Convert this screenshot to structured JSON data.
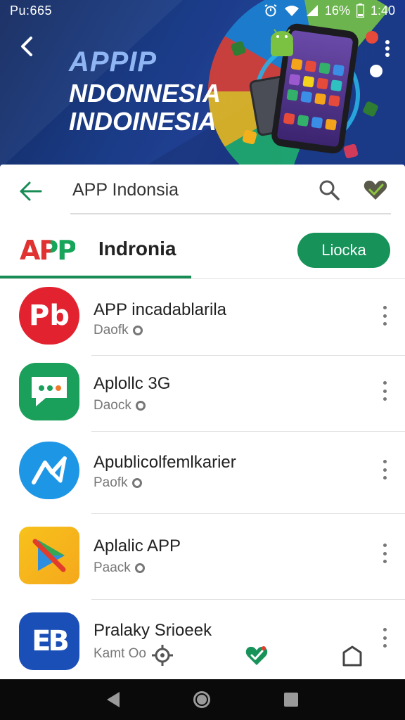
{
  "status_bar": {
    "left_text": "Pu:665",
    "battery": "16%",
    "time": "1:40",
    "icons": [
      "alarm-icon",
      "wifi-icon",
      "signal-icon",
      "battery-icon"
    ]
  },
  "banner": {
    "line1": "APPIP",
    "line2": "NDONNESIA",
    "line3": "INDOINESIA"
  },
  "search": {
    "query": "APP Indonsia"
  },
  "header": {
    "logo_text": "APP",
    "title": "Indronia",
    "cta_label": "Liocka"
  },
  "list": {
    "items": [
      {
        "title": "APP incadablarila",
        "subtitle": "Daofk",
        "icon": "pb-app-icon",
        "icon_text": "Pb"
      },
      {
        "title": "Aplollc 3G",
        "subtitle": "Daock",
        "icon": "chat-app-icon",
        "icon_text": ""
      },
      {
        "title": "Apublicolfemlkarier",
        "subtitle": "Paofk",
        "icon": "messenger-app-icon",
        "icon_text": ""
      },
      {
        "title": "Aplalic APP",
        "subtitle": "Paack",
        "icon": "play-app-icon",
        "icon_text": ""
      },
      {
        "title": "Pralaky Srioeek",
        "subtitle": "Kamt Oo",
        "icon": "eb-app-icon",
        "icon_text": "EB"
      }
    ]
  },
  "bottom_nav": {
    "icons": [
      "settings-icon",
      "heart-check-icon",
      "bag-icon"
    ]
  },
  "system_nav": {
    "icons": [
      "back-icon",
      "home-icon",
      "recents-icon"
    ]
  },
  "colors": {
    "brand_green": "#17935a",
    "logo_red": "#e13232",
    "banner_blue": "#1a3b86"
  }
}
